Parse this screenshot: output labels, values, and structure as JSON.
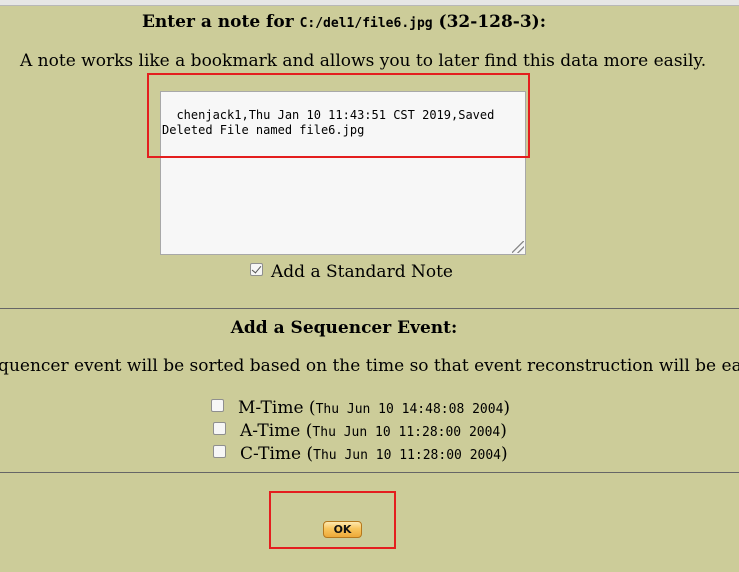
{
  "note": {
    "title_prefix": "Enter a note for ",
    "file_path": "C:/del1/file6.jpg",
    "title_suffix": " (32-128-3):",
    "description": "A note works like a bookmark and allows you to later find this data more easily.",
    "textarea_value": "chenjack1,Thu Jan 10 11:43:51 CST 2019,Saved Deleted File named file6.jpg",
    "standard_note_label": "Add a Standard Note",
    "standard_note_checked": true
  },
  "sequencer": {
    "title": "Add a Sequencer Event:",
    "description": "equencer event will be sorted based on the time so that event reconstruction will be easier",
    "events": [
      {
        "label": "M-Time",
        "open": " (",
        "timestamp": "Thu Jun 10 14:48:08 2004",
        "close": ")",
        "checked": false
      },
      {
        "label": "A-Time",
        "open": " (",
        "timestamp": "Thu Jun 10 11:28:00 2004",
        "close": ")",
        "checked": false
      },
      {
        "label": "C-Time",
        "open": " (",
        "timestamp": "Thu Jun 10 11:28:00 2004",
        "close": ")",
        "checked": false
      }
    ]
  },
  "actions": {
    "ok_label": "OK"
  },
  "colors": {
    "background": "#cccc99",
    "highlight_box": "#e41e1e",
    "ok_button": "#f8c65e"
  }
}
